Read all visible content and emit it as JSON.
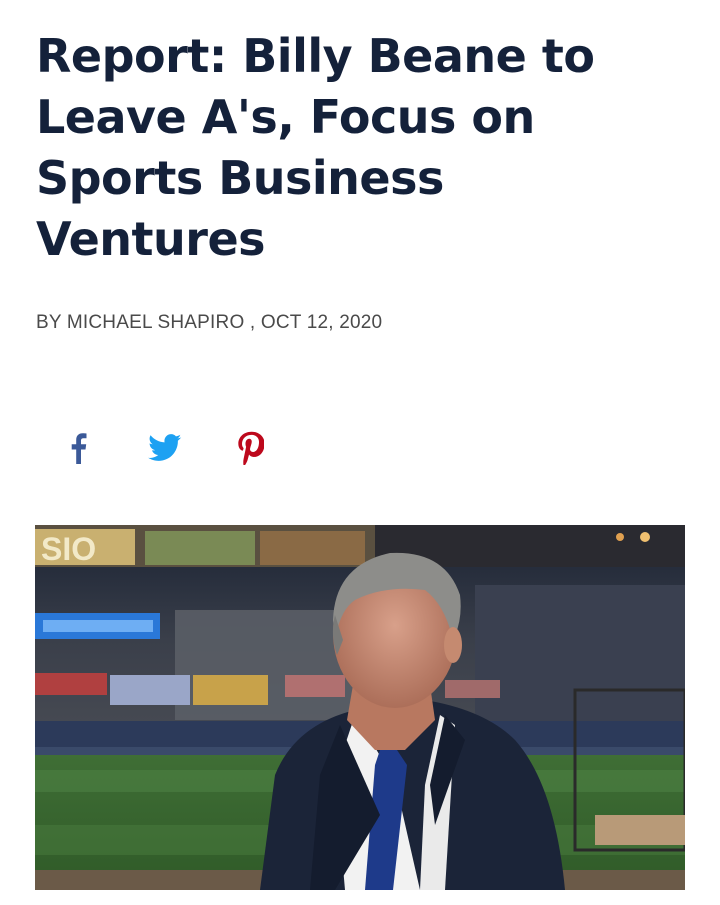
{
  "article": {
    "headline": "Report: Billy Beane to Leave A's, Focus on Sports Business Ventures",
    "byline": "BY MICHAEL SHAPIRO , OCT 12, 2020"
  },
  "share": {
    "facebook_icon": "facebook-icon",
    "twitter_icon": "twitter-icon",
    "pinterest_icon": "pinterest-icon",
    "facebook_color": "#3b5998",
    "twitter_color": "#1da1f2",
    "pinterest_color": "#bd081c"
  },
  "hero_image": {
    "scoreboard_text": "SIO"
  },
  "colors": {
    "headline": "#14213a",
    "byline": "#4a4a4a"
  }
}
